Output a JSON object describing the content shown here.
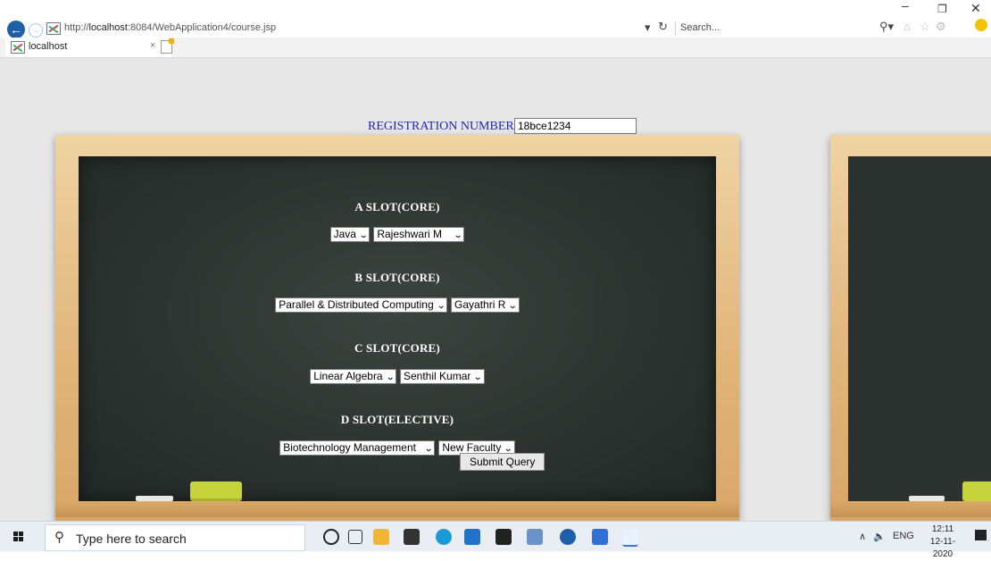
{
  "browser": {
    "url_prefix": "http://",
    "url_host": "localhost",
    "url_rest": ":8084/WebApplication4/course.jsp",
    "search_placeholder": "Search...",
    "tab_title": "localhost",
    "window_controls": {
      "minimize": "–",
      "restore": "❐",
      "close": "✕"
    }
  },
  "page": {
    "registration_label": "REGISTRATION NUMBER",
    "registration_value": "18bce1234",
    "slots": [
      {
        "title": "A SLOT(CORE)",
        "course": "Java",
        "faculty": "Rajeshwari M"
      },
      {
        "title": "B SLOT(CORE)",
        "course": "Parallel & Distributed Computing",
        "faculty": "Gayathri R"
      },
      {
        "title": "C SLOT(CORE)",
        "course": "Linear Algebra",
        "faculty": "Senthil Kumar"
      },
      {
        "title": "D SLOT(ELECTIVE)",
        "course": "Biotechnology Management",
        "faculty": "New Faculty"
      }
    ],
    "submit_label": "Submit Query"
  },
  "taskbar": {
    "search_placeholder": "Type here to search",
    "language": "ENG",
    "time": "12:11",
    "date": "12-11-2020"
  },
  "colors": {
    "registration_label": "#2323b8",
    "board": "#2b322f",
    "frame": "#e2b67c",
    "eraser": "#c6d33c"
  }
}
